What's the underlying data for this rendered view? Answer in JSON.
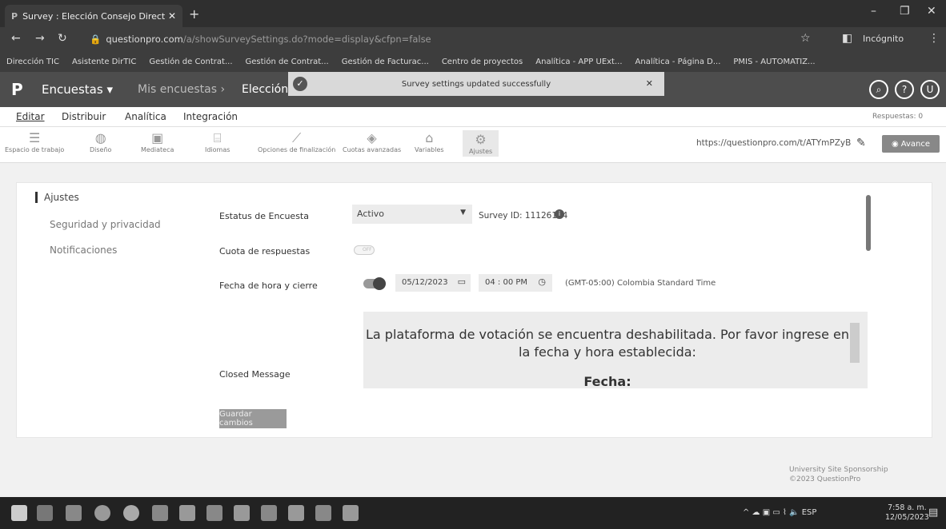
{
  "browser": {
    "tab_title": "Survey : Elección Consejo Direct",
    "url_domain": "questionpro.com",
    "url_path": "/a/showSurveySettings.do?mode=display&cfpn=false",
    "profile_label": "Incógnito",
    "bookmarks": [
      "Dirección TIC",
      "Asistente DirTIC",
      "Gestión de Contrat...",
      "Gestión de Contrat...",
      "Gestión de Facturac...",
      "Centro de proyectos",
      "Analítica - APP UExt...",
      "Analítica - Página D...",
      "PMIS - AUTOMATIZ..."
    ]
  },
  "header": {
    "menu_label": "Encuestas",
    "crumb_1": "Mis encuestas",
    "crumb_2": "Elección",
    "toast_message": "Survey settings updated successfully"
  },
  "tabs": {
    "editar": "Editar",
    "distribuir": "Distribuir",
    "analitica": "Analítica",
    "integracion": "Integración",
    "respuestas": "Respuestas: 0"
  },
  "toolbar": {
    "items": [
      "Espacio de trabajo",
      "Diseño",
      "Mediateca",
      "Idiomas",
      "Opciones de finalización",
      "Cuotas avanzadas",
      "Variables",
      "Ajustes"
    ],
    "survey_url": "https://questionpro.com/t/ATYmPZyB",
    "preview_label": "Avance"
  },
  "sidebar": {
    "items": [
      "Ajustes",
      "Seguridad y privacidad",
      "Notificaciones"
    ]
  },
  "settings": {
    "status_label": "Estatus de Encuesta",
    "status_value": "Activo",
    "survey_id": "Survey ID: 11126154",
    "quota_label": "Cuota de respuestas",
    "quota_state": "OFF",
    "close_label": "Fecha de hora y cierre",
    "close_date": "05/12/2023",
    "close_time": "04 : 00 PM",
    "timezone": "(GMT-05:00) Colombia Standard Time",
    "closed_message_label": "Closed Message",
    "closed_message_line1": "La plataforma de votación se encuentra deshabilitada. Por favor ingrese en la fecha y hora establecida:",
    "closed_message_line2": "Fecha:",
    "save_label": "Guardar cambios"
  },
  "footer": {
    "line1": "University Site Sponsorship",
    "line2": "©2023 QuestionPro"
  },
  "taskbar": {
    "lang": "ESP",
    "time": "7:58 a. m.",
    "date": "12/05/2023"
  }
}
